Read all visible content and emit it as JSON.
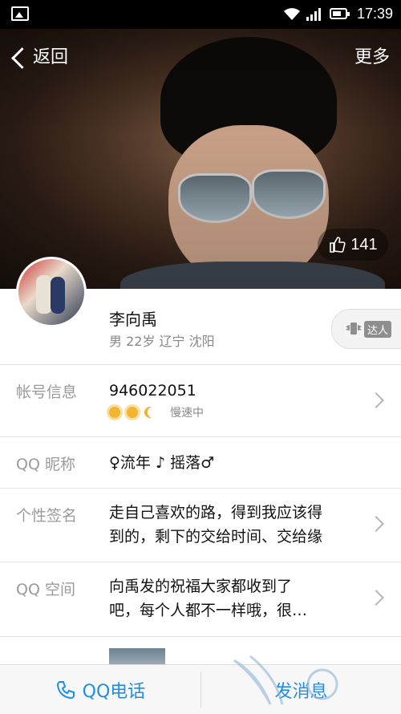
{
  "status_bar": {
    "time": "17:39"
  },
  "header": {
    "back_label": "返回",
    "more_label": "更多",
    "likes": "141"
  },
  "profile": {
    "name": "李向禹",
    "meta": "男 22岁 辽宁 沈阳",
    "badge_label": "达人"
  },
  "rows": {
    "account": {
      "label": "帐号信息",
      "value": "946022051",
      "status": "慢速中"
    },
    "nickname": {
      "label": "QQ 昵称",
      "value": "♀流年 ♪  摇落♂"
    },
    "signature": {
      "label": "个性签名",
      "line1": "走自己喜欢的路，得到我应该得",
      "line2": "到的，剩下的交给时间、交给缘"
    },
    "qzone": {
      "label": "QQ 空间",
      "line1": "向禹发的祝福大家都收到了",
      "line2": "吧，每个人都不一样哦，很…"
    }
  },
  "bottom_bar": {
    "call_label": "QQ电话",
    "send_label": "发消息"
  },
  "colors": {
    "accent": "#1e8ee8",
    "label_gray": "#9a9a9a"
  }
}
